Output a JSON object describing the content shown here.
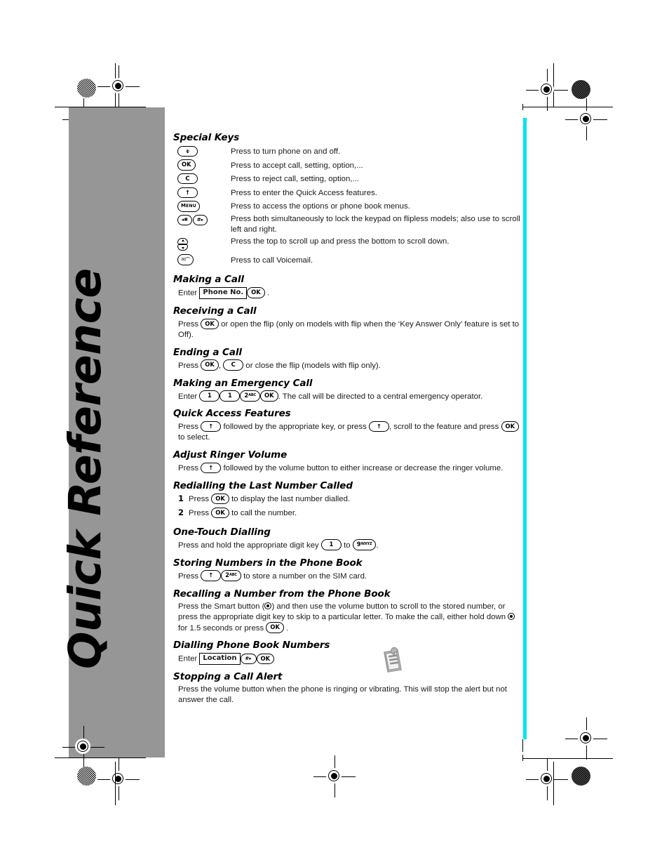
{
  "page": {
    "vertical_title": "Quick Reference",
    "panel_color": "#969696",
    "cyan_mark_color": "#00e5ee"
  },
  "sections": [
    {
      "id": "special-keys",
      "heading": "Special Keys",
      "rows": [
        {
          "keys": [
            "power"
          ],
          "desc": "Press to turn phone on and off."
        },
        {
          "keys": [
            "ok"
          ],
          "desc": "Press to accept call, setting, option,..."
        },
        {
          "keys": [
            "c"
          ],
          "desc": "Press to reject call, setting, option,..."
        },
        {
          "keys": [
            "up"
          ],
          "desc": "Press to enter the Quick Access features."
        },
        {
          "keys": [
            "menu"
          ],
          "desc": "Press to access the options or phone book menus."
        },
        {
          "keys": [
            "star",
            "hash"
          ],
          "desc": "Press both simultaneously to lock the keypad on flipless models; also use to scroll left and right."
        },
        {
          "keys": [
            "rocker"
          ],
          "desc": "Press the top to scroll up and press the bottom to scroll down."
        },
        {
          "keys": [
            "voicemail"
          ],
          "desc": "Press to call Voicemail."
        }
      ]
    },
    {
      "id": "making-a-call",
      "heading": "Making a Call",
      "line_pre": "Enter",
      "boxlabel": "Phone No.",
      "key": "OK",
      "line_post": "."
    },
    {
      "id": "receiving-a-call",
      "heading": "Receiving a Call",
      "pre": "Press",
      "key": "OK",
      "post": "or open the flip (only on models with flip when the ‘Key Answer Only’  feature is set to Off)."
    },
    {
      "id": "ending-a-call",
      "heading": "Ending a Call",
      "pre": "Press",
      "key1": "OK",
      "sep": ",",
      "key2": "C",
      "post": "or close the flip (models with flip only)."
    },
    {
      "id": "emergency-call",
      "heading": "Making an Emergency Call",
      "pre": "Enter",
      "keys": [
        "1",
        "1",
        "2abc",
        "OK"
      ],
      "post": ". The call will be directed to a central emergency operator."
    },
    {
      "id": "quick-access",
      "heading": "Quick Access Features",
      "pre": "Press",
      "key1": "up",
      "mid1": "followed by the appropriate key, or press",
      "key2": "up",
      "mid2": ", scroll to the feature and press",
      "key3": "OK",
      "post": "to select."
    },
    {
      "id": "ringer-volume",
      "heading": "Adjust Ringer Volume",
      "pre": "Press",
      "key": "up",
      "post": "followed by the volume button to either increase or decrease the ringer volume."
    },
    {
      "id": "redial",
      "heading": "Redialling the Last Number Called",
      "steps": [
        {
          "num": "1",
          "pre": "Press",
          "key": "OK",
          "post": "to display the last number dialled."
        },
        {
          "num": "2",
          "pre": "Press",
          "key": "OK",
          "post": "to call the number."
        }
      ]
    },
    {
      "id": "one-touch-dialling",
      "heading": "One-Touch Dialling",
      "pre": "Press and hold the appropriate digit key",
      "key1": "1",
      "mid": "to",
      "key2": "9wxyz",
      "post": "."
    },
    {
      "id": "storing-numbers",
      "heading": "Storing Numbers in the Phone Book",
      "pre": "Press",
      "key1": "up",
      "key2": "2abc",
      "post": "to store a number on the SIM card."
    },
    {
      "id": "recalling-number",
      "heading": "Recalling a Number from the Phone Book",
      "part1": "Press the Smart button (",
      "part2": ") and then use the volume button to scroll to the stored number, or press the appropriate digit key to skip to a particular letter. To make the call, either hold down",
      "part3": "for 1.5 seconds or press",
      "key": "OK",
      "part4": "."
    },
    {
      "id": "dialling-phone-book",
      "heading": "Dialling Phone Book Numbers",
      "pre": "Enter",
      "boxlabel": "Location",
      "key1": "#",
      "key2": "OK"
    },
    {
      "id": "stopping-call-alert",
      "heading": "Stopping a Call Alert",
      "text": "Press the volume button when the phone is ringing or vibrating. This will stop the alert but not answer the call."
    }
  ],
  "key_glyphs": {
    "power": "⌽",
    "ok": "OK",
    "c": "C",
    "up": "↑",
    "menu": "Menu",
    "star": "◂✱",
    "hash": "#▸",
    "voicemail": "✉",
    "one": "1",
    "two": "2",
    "two_sub": "ABC",
    "nine": "9",
    "nine_sub": "WXYZ",
    "hash_plain": "#▸"
  }
}
